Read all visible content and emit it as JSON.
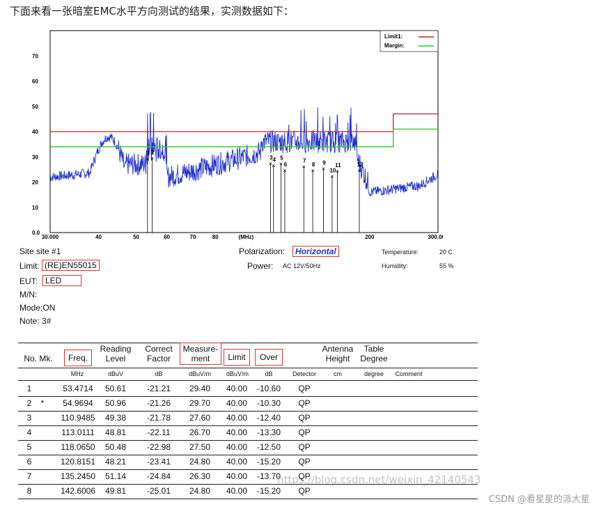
{
  "intro": "下面来看一张暗室EMC水平方向测试的结果，实测数据如下：",
  "chart_data": {
    "type": "line",
    "x_scale": "log",
    "xlim": [
      30,
      300
    ],
    "ylim": [
      0,
      80
    ],
    "x_ticks": [
      "30.000",
      "40",
      "50",
      "60",
      "70",
      "80",
      "(MHz)",
      "200",
      "300.000"
    ],
    "y_ticks": [
      "0.0",
      "10",
      "20",
      "30",
      "40",
      "50",
      "60",
      "70"
    ],
    "legend": [
      {
        "name": "Limit1:",
        "color": "#cc2222"
      },
      {
        "name": "Margin:",
        "color": "#22cc22"
      }
    ],
    "limit": [
      [
        30,
        40
      ],
      [
        230,
        40
      ],
      [
        230,
        47
      ],
      [
        300,
        47
      ]
    ],
    "margin": [
      [
        30,
        34
      ],
      [
        230,
        34
      ],
      [
        230,
        41
      ],
      [
        300,
        41
      ]
    ],
    "markers": [
      {
        "label": "1",
        "freq": 53.4714,
        "level": 29.4
      },
      {
        "label": "2",
        "freq": 54.9694,
        "level": 29.7
      },
      {
        "label": "3",
        "freq": 110.9485,
        "level": 27.6
      },
      {
        "label": "4",
        "freq": 113.0111,
        "level": 26.7
      },
      {
        "label": "5",
        "freq": 118.065,
        "level": 27.5
      },
      {
        "label": "6",
        "freq": 120.8151,
        "level": 24.8
      },
      {
        "label": "7",
        "freq": 135.245,
        "level": 26.3
      },
      {
        "label": "8",
        "freq": 142.6006,
        "level": 24.8
      },
      {
        "label": "9",
        "freq": 152,
        "level": 25.5
      },
      {
        "label": "10",
        "freq": 160,
        "level": 22.5
      },
      {
        "label": "11",
        "freq": 165,
        "level": 24.5
      },
      {
        "label": "12",
        "freq": 188,
        "level": 24.8
      }
    ],
    "colors": {
      "trace": "#1f2fd0",
      "limit": "#cc2222",
      "margin": "#22cc22",
      "box_accent": "#d33333"
    }
  },
  "site": "Site  site #1",
  "polarization_label": "Polarization:",
  "polarization_value": "Horizontal",
  "temperature_label": "Temperature:",
  "temperature_value": "20 C",
  "limit_label": "Limit:",
  "limit_value": "(RE)EN55015",
  "power_label": "Power:",
  "power_value": "AC 12V/50Hz",
  "humidity_label": "Humidity:",
  "humidity_value": "55 %",
  "eut_label": "EUT:",
  "eut_value": "LED",
  "mn": "M/N:",
  "mode": "Mode:ON",
  "note": "Note:  3#",
  "table": {
    "headers": {
      "no": "No. Mk.",
      "freq": "Freq.",
      "reading": "Reading\nLevel",
      "correct": "Correct\nFactor",
      "measure": "Measure-\nment",
      "limit": "Limit",
      "over": "Over",
      "antenna": "Antenna\nHeight",
      "table": "Table\nDegree"
    },
    "units": [
      "MHz",
      "dBuV",
      "dB",
      "dBuV/m",
      "dBuV/m",
      "dB",
      "Detector",
      "cm",
      "degree",
      "Comment"
    ],
    "rows": [
      {
        "no": "1",
        "mk": "",
        "freq": "53.4714",
        "reading": "50.61",
        "correct": "-21.21",
        "measure": "29.40",
        "limit": "40.00",
        "over": "-10.60",
        "det": "QP"
      },
      {
        "no": "2",
        "mk": "*",
        "freq": "54.9694",
        "reading": "50.96",
        "correct": "-21.26",
        "measure": "29.70",
        "limit": "40.00",
        "over": "-10.30",
        "det": "QP"
      },
      {
        "no": "3",
        "mk": "",
        "freq": "110.9485",
        "reading": "49.38",
        "correct": "-21.78",
        "measure": "27.60",
        "limit": "40.00",
        "over": "-12.40",
        "det": "QP"
      },
      {
        "no": "4",
        "mk": "",
        "freq": "113.0111",
        "reading": "48.81",
        "correct": "-22.11",
        "measure": "26.70",
        "limit": "40.00",
        "over": "-13.30",
        "det": "QP"
      },
      {
        "no": "5",
        "mk": "",
        "freq": "118.0650",
        "reading": "50.48",
        "correct": "-22.98",
        "measure": "27.50",
        "limit": "40.00",
        "over": "-12.50",
        "det": "QP"
      },
      {
        "no": "6",
        "mk": "",
        "freq": "120.8151",
        "reading": "48.21",
        "correct": "-23.41",
        "measure": "24.80",
        "limit": "40.00",
        "over": "-15.20",
        "det": "QP"
      },
      {
        "no": "7",
        "mk": "",
        "freq": "135.2450",
        "reading": "51.14",
        "correct": "-24.84",
        "measure": "26.30",
        "limit": "40.00",
        "over": "-13.70",
        "det": "QP"
      },
      {
        "no": "8",
        "mk": "",
        "freq": "142.6006",
        "reading": "49.81",
        "correct": "-25.01",
        "measure": "24.80",
        "limit": "40.00",
        "over": "-15.20",
        "det": "QP"
      }
    ]
  },
  "watermark": "https://blog.csdn.net/weixin_42140543",
  "credit": "CSDN @看星星的派大星"
}
